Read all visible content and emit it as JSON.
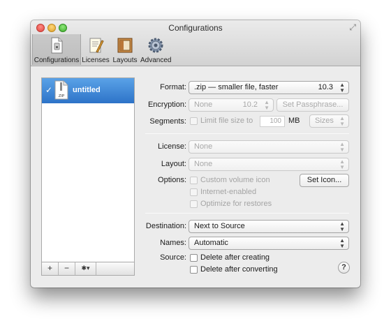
{
  "window": {
    "title": "Configurations"
  },
  "toolbar": {
    "items": [
      {
        "label": "Configurations",
        "icon": "configurations-doc-icon"
      },
      {
        "label": "Licenses",
        "icon": "licenses-icon"
      },
      {
        "label": "Layouts",
        "icon": "layouts-icon"
      },
      {
        "label": "Advanced",
        "icon": "gear-icon"
      }
    ]
  },
  "sidebar": {
    "items": [
      {
        "name": "untitled",
        "checked": true,
        "file_badge": "ZIP"
      }
    ],
    "add_label": "+",
    "remove_label": "−",
    "action_label": "✱▾"
  },
  "form": {
    "format": {
      "label": "Format:",
      "value": ".zip — smaller file, faster",
      "version": "10.3"
    },
    "encryption": {
      "label": "Encryption:",
      "value": "None",
      "version": "10.2",
      "button": "Set Passphrase..."
    },
    "segments": {
      "label": "Segments:",
      "checkbox": "Limit file size to",
      "size": "100",
      "unit": "MB",
      "sizes_label": "Sizes"
    },
    "license": {
      "label": "License:",
      "value": "None"
    },
    "layout": {
      "label": "Layout:",
      "value": "None"
    },
    "options": {
      "label": "Options:",
      "custom_icon": "Custom volume icon",
      "set_icon_button": "Set Icon...",
      "internet_enabled": "Internet-enabled",
      "optimize": "Optimize for restores"
    },
    "destination": {
      "label": "Destination:",
      "value": "Next to Source"
    },
    "names": {
      "label": "Names:",
      "value": "Automatic"
    },
    "source": {
      "label": "Source:",
      "delete_creating": "Delete after creating",
      "delete_converting": "Delete after converting"
    },
    "help": "?"
  },
  "colors": {
    "selection": "#2d73c8",
    "window_bg": "#ececec"
  }
}
